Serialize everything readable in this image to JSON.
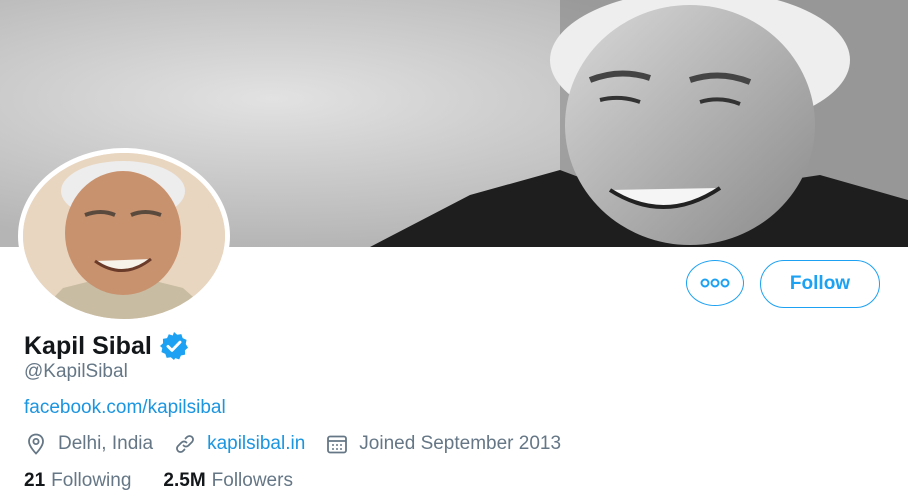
{
  "profile": {
    "name": "Kapil Sibal",
    "handle": "@KapilSibal",
    "bio_link": "facebook.com/kapilsibal",
    "verified": true
  },
  "meta": {
    "location": "Delhi, India",
    "website": "kapilsibal.in",
    "joined": "Joined September 2013"
  },
  "stats": {
    "following_count": "21",
    "following_label": "Following",
    "followers_count": "2.5M",
    "followers_label": "Followers"
  },
  "actions": {
    "follow_label": "Follow"
  },
  "icons": {
    "more": "more-icon",
    "verified": "verified-badge-icon",
    "location": "location-pin-icon",
    "website": "link-icon",
    "joined": "calendar-icon"
  },
  "colors": {
    "accent": "#1da1f2",
    "link": "#1b95e0",
    "secondary_text": "#657786",
    "primary_text": "#14171a"
  }
}
